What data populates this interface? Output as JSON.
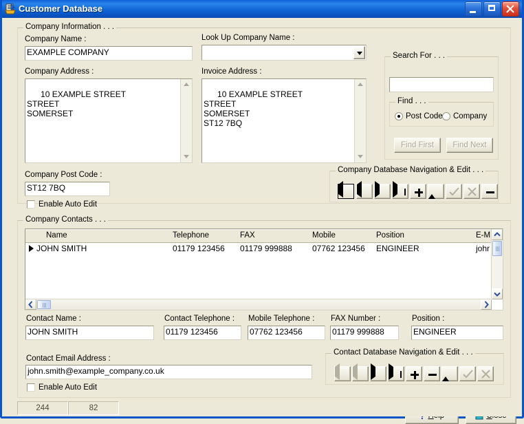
{
  "window": {
    "title": "Customer Database",
    "icon": "database-icon",
    "accent": "#0a55c8",
    "face": "#ece9d8",
    "buttons": {
      "minimize": "Minimize",
      "maximize": "Maximize",
      "close": "Close"
    }
  },
  "company_information": {
    "caption": "Company Information . . .",
    "company_name_label": "Company Name :",
    "company_name_value": "EXAMPLE COMPANY",
    "lookup_label": "Look Up Company Name :",
    "lookup_value": "",
    "company_address_label": "Company Address :",
    "company_address_value": "10 EXAMPLE STREET\nSTREET\nSOMERSET",
    "invoice_address_label": "Invoice Address :",
    "invoice_address_value": "10 EXAMPLE STREET\nSTREET\nSOMERSET\nST12 7BQ",
    "post_code_label": "Company Post Code :",
    "post_code_value": "ST12 7BQ",
    "auto_edit_label": "Enable Auto Edit",
    "auto_edit_checked": "false"
  },
  "search": {
    "caption": "Search For . . .",
    "input_value": "",
    "find_caption": "Find . . .",
    "radio_post_code": "Post Code",
    "radio_company": "Company",
    "selected": "Post Code",
    "find_first": "Find First",
    "find_next": "Find Next"
  },
  "company_nav": {
    "caption": "Company Database Navigation & Edit . . .",
    "buttons": [
      {
        "name": "first-record",
        "glyph": "first"
      },
      {
        "name": "prior-record",
        "glyph": "prev"
      },
      {
        "name": "next-record",
        "glyph": "next"
      },
      {
        "name": "last-record",
        "glyph": "last"
      },
      {
        "name": "insert-record",
        "glyph": "plus"
      },
      {
        "name": "post-edit",
        "glyph": "up"
      },
      {
        "name": "accept-edit",
        "glyph": "check"
      },
      {
        "name": "cancel-edit",
        "glyph": "cancel"
      },
      {
        "name": "delete-record",
        "glyph": "minus"
      }
    ]
  },
  "company_contacts": {
    "caption": "Company Contacts . . .",
    "columns": [
      "Name",
      "Telephone",
      "FAX",
      "Mobile",
      "Position",
      "E-M"
    ],
    "rows": [
      {
        "name": "JOHN SMITH",
        "telephone": "01179 123456",
        "fax": "01179 999888",
        "mobile": "07762 123456",
        "position": "ENGINEER",
        "email": "johr"
      }
    ]
  },
  "contact_details": {
    "contact_name_label": "Contact Name :",
    "contact_name_value": "JOHN SMITH",
    "contact_telephone_label": "Contact Telephone :",
    "contact_telephone_value": "01179 123456",
    "mobile_telephone_label": "Mobile Telephone :",
    "mobile_telephone_value": "07762 123456",
    "fax_number_label": "FAX Number :",
    "fax_number_value": "01179 999888",
    "position_label": "Position :",
    "position_value": "ENGINEER",
    "email_label": "Contact Email Address :",
    "email_value": "john.smith@example_company.co.uk",
    "auto_edit_label": "Enable Auto Edit",
    "auto_edit_checked": "false"
  },
  "contact_nav": {
    "caption": "Contact Database Navigation & Edit . . .",
    "buttons": [
      {
        "name": "first-record",
        "glyph": "first"
      },
      {
        "name": "prior-record",
        "glyph": "prev"
      },
      {
        "name": "next-record",
        "glyph": "next"
      },
      {
        "name": "last-record",
        "glyph": "last"
      },
      {
        "name": "insert-record",
        "glyph": "plus"
      },
      {
        "name": "delete-record",
        "glyph": "minus"
      },
      {
        "name": "post-edit",
        "glyph": "up"
      },
      {
        "name": "accept-edit",
        "glyph": "check"
      },
      {
        "name": "cancel-edit",
        "glyph": "cancel"
      }
    ]
  },
  "status_bar": {
    "panel_1": "244",
    "panel_2": "82"
  },
  "footer": {
    "help_button": "Help",
    "help_accel": "H",
    "close_button": "Close",
    "close_accel": "C"
  }
}
